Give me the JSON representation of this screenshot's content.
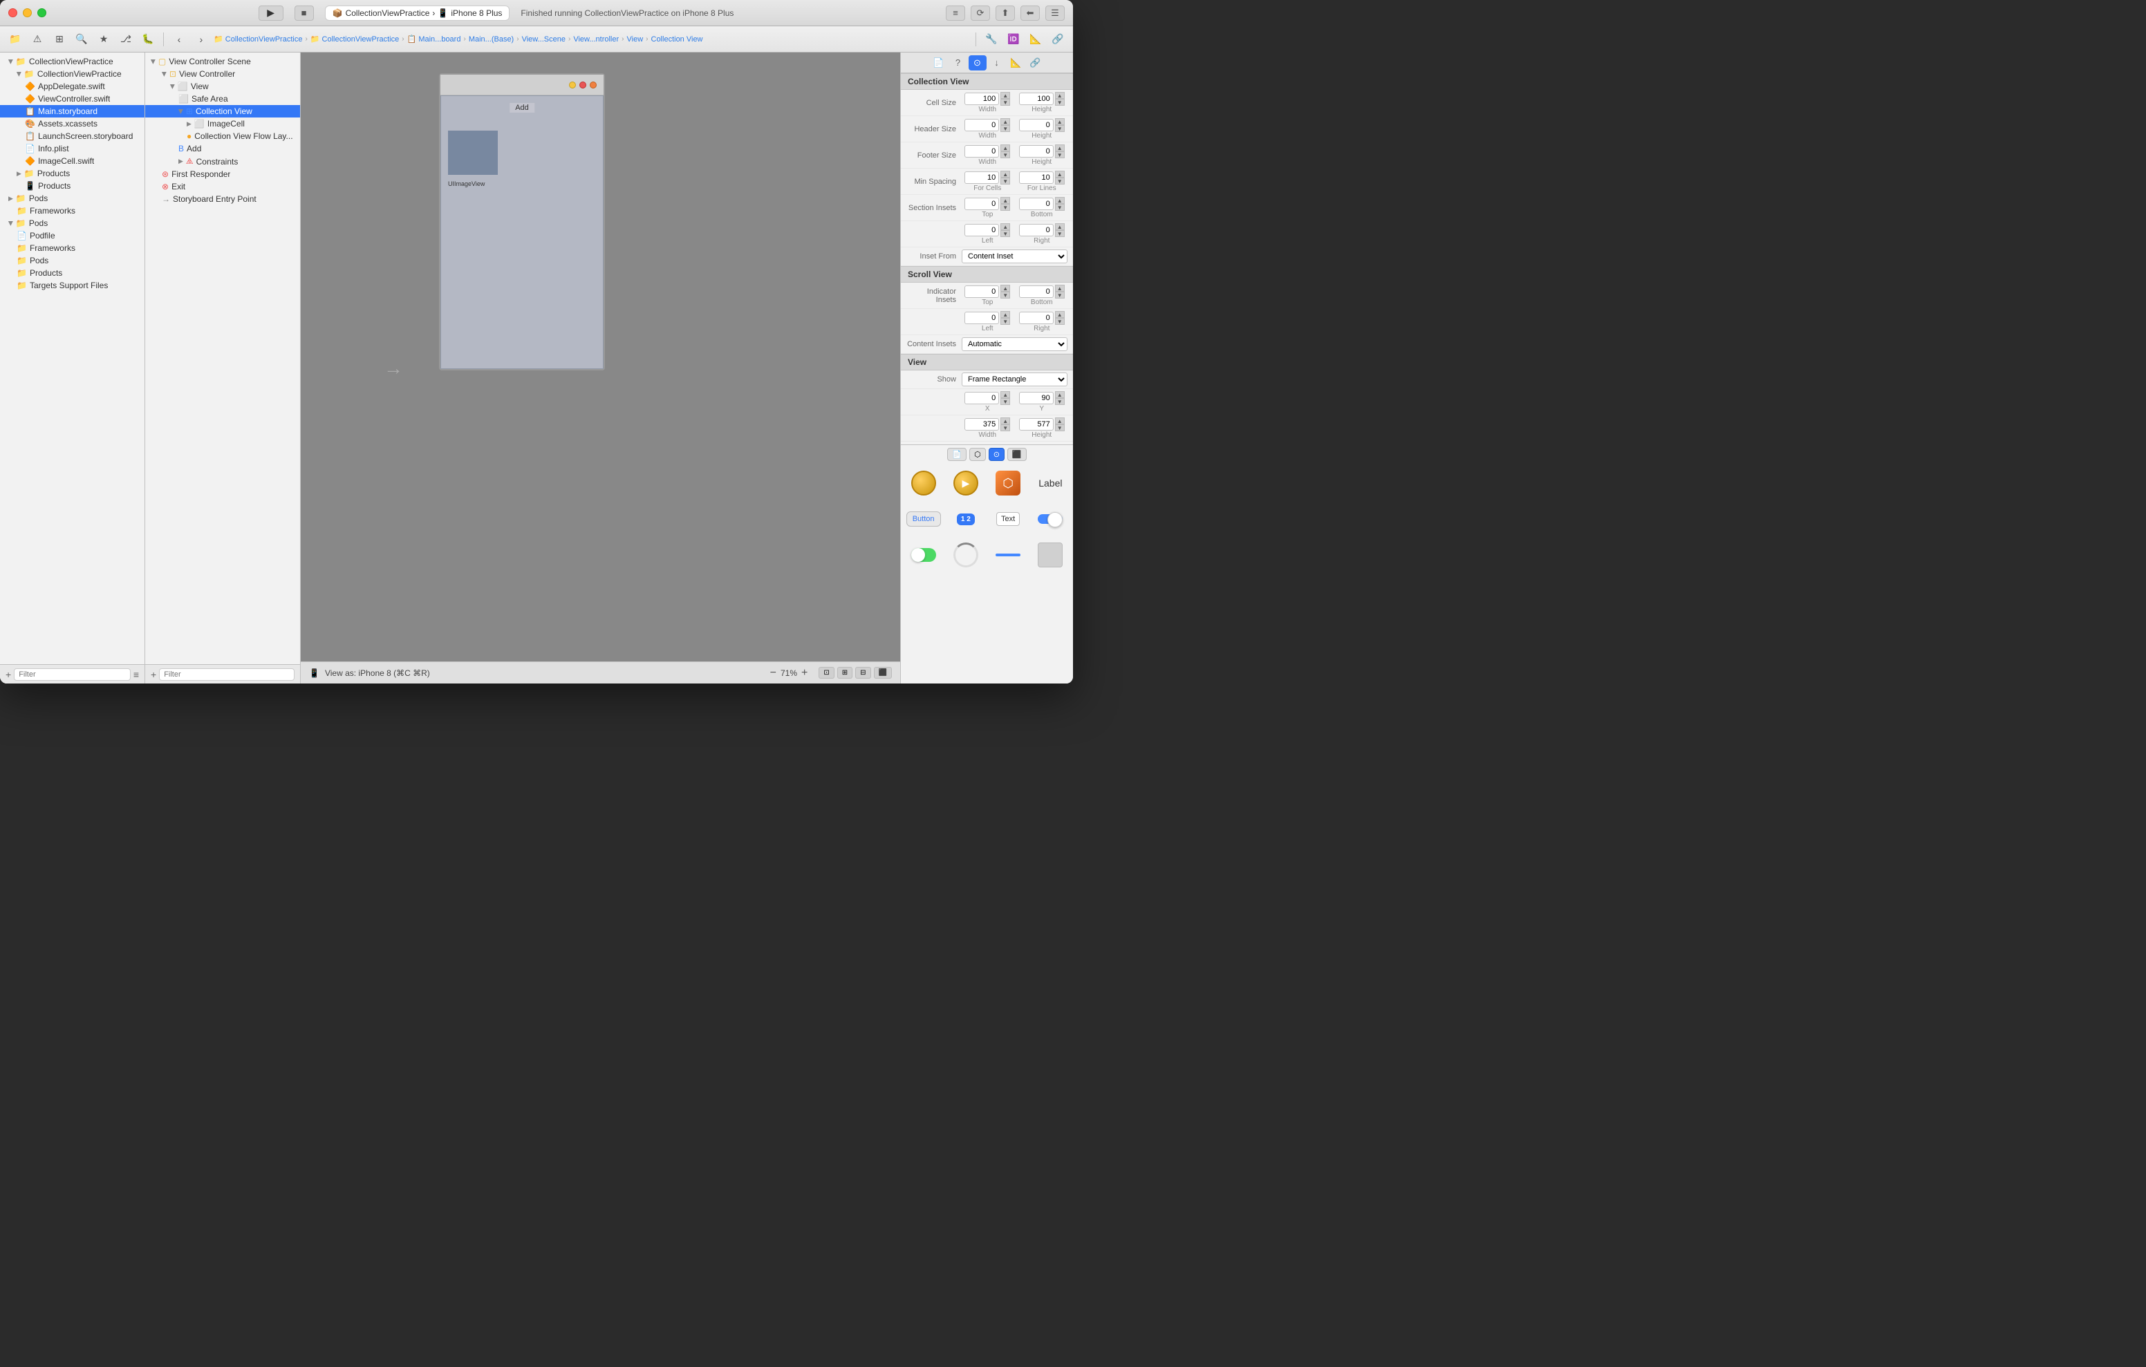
{
  "window": {
    "title": "CollectionViewPractice — iPhone 8 Plus"
  },
  "titlebar": {
    "project_btn": "CollectionViewPractice",
    "device_btn": "iPhone 8 Plus",
    "status": "Finished running CollectionViewPractice on iPhone 8 Plus"
  },
  "toolbar": {
    "breadcrumb": [
      "CollectionViewPractice",
      "CollectionViewPractice",
      "Main...board",
      "Main...(Base)",
      "View...Scene",
      "View...ntroller",
      "View",
      "Collection View"
    ]
  },
  "file_tree": {
    "items": [
      {
        "label": "CollectionViewPractice",
        "level": 0,
        "type": "project",
        "expanded": true
      },
      {
        "label": "CollectionViewPractice",
        "level": 1,
        "type": "folder",
        "expanded": true
      },
      {
        "label": "AppDelegate.swift",
        "level": 2,
        "type": "swift"
      },
      {
        "label": "ViewController.swift",
        "level": 2,
        "type": "swift"
      },
      {
        "label": "Main.storyboard",
        "level": 2,
        "type": "storyboard",
        "selected": true
      },
      {
        "label": "Assets.xcassets",
        "level": 2,
        "type": "assets"
      },
      {
        "label": "LaunchScreen.storyboard",
        "level": 2,
        "type": "storyboard"
      },
      {
        "label": "Info.plist",
        "level": 2,
        "type": "plist"
      },
      {
        "label": "ImageCell.swift",
        "level": 2,
        "type": "swift"
      },
      {
        "label": "Products",
        "level": 1,
        "type": "folder",
        "expanded": true
      },
      {
        "label": "Products",
        "level": 2,
        "type": "product"
      },
      {
        "label": "Pods",
        "level": 1,
        "type": "folder",
        "expanded": false
      },
      {
        "label": "Frameworks",
        "level": 2,
        "type": "folder"
      },
      {
        "label": "Pods",
        "level": 1,
        "type": "folder",
        "expanded": true
      },
      {
        "label": "Podfile",
        "level": 2,
        "type": "file"
      },
      {
        "label": "Frameworks",
        "level": 2,
        "type": "folder"
      },
      {
        "label": "Pods",
        "level": 2,
        "type": "folder"
      },
      {
        "label": "Products",
        "level": 2,
        "type": "folder"
      },
      {
        "label": "Targets Support Files",
        "level": 2,
        "type": "folder"
      }
    ]
  },
  "scene_tree": {
    "title": "View Controller Scene",
    "items": [
      {
        "label": "View Controller Scene",
        "level": 0,
        "type": "scene",
        "expanded": true
      },
      {
        "label": "View Controller",
        "level": 1,
        "type": "controller",
        "expanded": true
      },
      {
        "label": "View",
        "level": 2,
        "type": "view",
        "expanded": true
      },
      {
        "label": "Safe Area",
        "level": 3,
        "type": "safe"
      },
      {
        "label": "Collection View",
        "level": 3,
        "type": "collection",
        "selected": true
      },
      {
        "label": "ImageCell",
        "level": 4,
        "type": "cell"
      },
      {
        "label": "Collection View Flow Lay...",
        "level": 4,
        "type": "layout"
      },
      {
        "label": "Add",
        "level": 3,
        "type": "button"
      },
      {
        "label": "Constraints",
        "level": 3,
        "type": "constraints"
      },
      {
        "label": "First Responder",
        "level": 1,
        "type": "responder"
      },
      {
        "label": "Exit",
        "level": 1,
        "type": "exit"
      },
      {
        "label": "Storyboard Entry Point",
        "level": 1,
        "type": "entry"
      }
    ]
  },
  "canvas": {
    "phone": {
      "add_label": "Add",
      "ui_image_view_label": "UIImageView"
    },
    "bottom_bar": {
      "view_as": "View as: iPhone 8 (⌘C ⌘R)",
      "zoom": "71%"
    }
  },
  "right_panel": {
    "section_collection_view": "Collection View",
    "cell_size": {
      "width": "100",
      "height": "100"
    },
    "header_size": {
      "width": "0",
      "height": "0"
    },
    "footer_size": {
      "width": "0",
      "height": "0"
    },
    "min_spacing_cells": "10",
    "min_spacing_lines": "10",
    "section_insets": {
      "top": "0",
      "bottom": "0",
      "left": "0",
      "right": "0"
    },
    "inset_from": "Content Inset",
    "section_scroll_view": "Scroll View",
    "indicator_insets": {
      "top": "0",
      "bottom": "0",
      "left": "0",
      "right": "0"
    },
    "content_insets": "Automatic",
    "section_view": "View",
    "show": "Frame Rectangle",
    "view_x": "0",
    "view_y": "90",
    "view_width": "375",
    "view_height": "577",
    "labels": {
      "cell_size": "Cell Size",
      "width": "Width",
      "height": "Height",
      "header_size": "Header Size",
      "footer_size": "Footer Size",
      "min_spacing": "Min Spacing",
      "for_cells": "For Cells",
      "for_lines": "For Lines",
      "section_insets": "Section Insets",
      "top": "Top",
      "bottom": "Bottom",
      "left": "Left",
      "right": "Right",
      "inset_from": "Inset From",
      "indicator_insets": "Indicator Insets",
      "content_insets": "Content Insets",
      "show": "Show",
      "x": "X",
      "y": "Y",
      "width2": "Width",
      "height2": "Height"
    }
  },
  "widget_library": {
    "widgets": [
      {
        "label": ""
      },
      {
        "label": ""
      },
      {
        "label": ""
      },
      {
        "label": "Label"
      },
      {
        "label": "Button"
      },
      {
        "label": "1  2"
      },
      {
        "label": "Text"
      },
      {
        "label": ""
      },
      {
        "label": ""
      },
      {
        "label": ""
      },
      {
        "label": ""
      },
      {
        "label": ""
      }
    ]
  }
}
